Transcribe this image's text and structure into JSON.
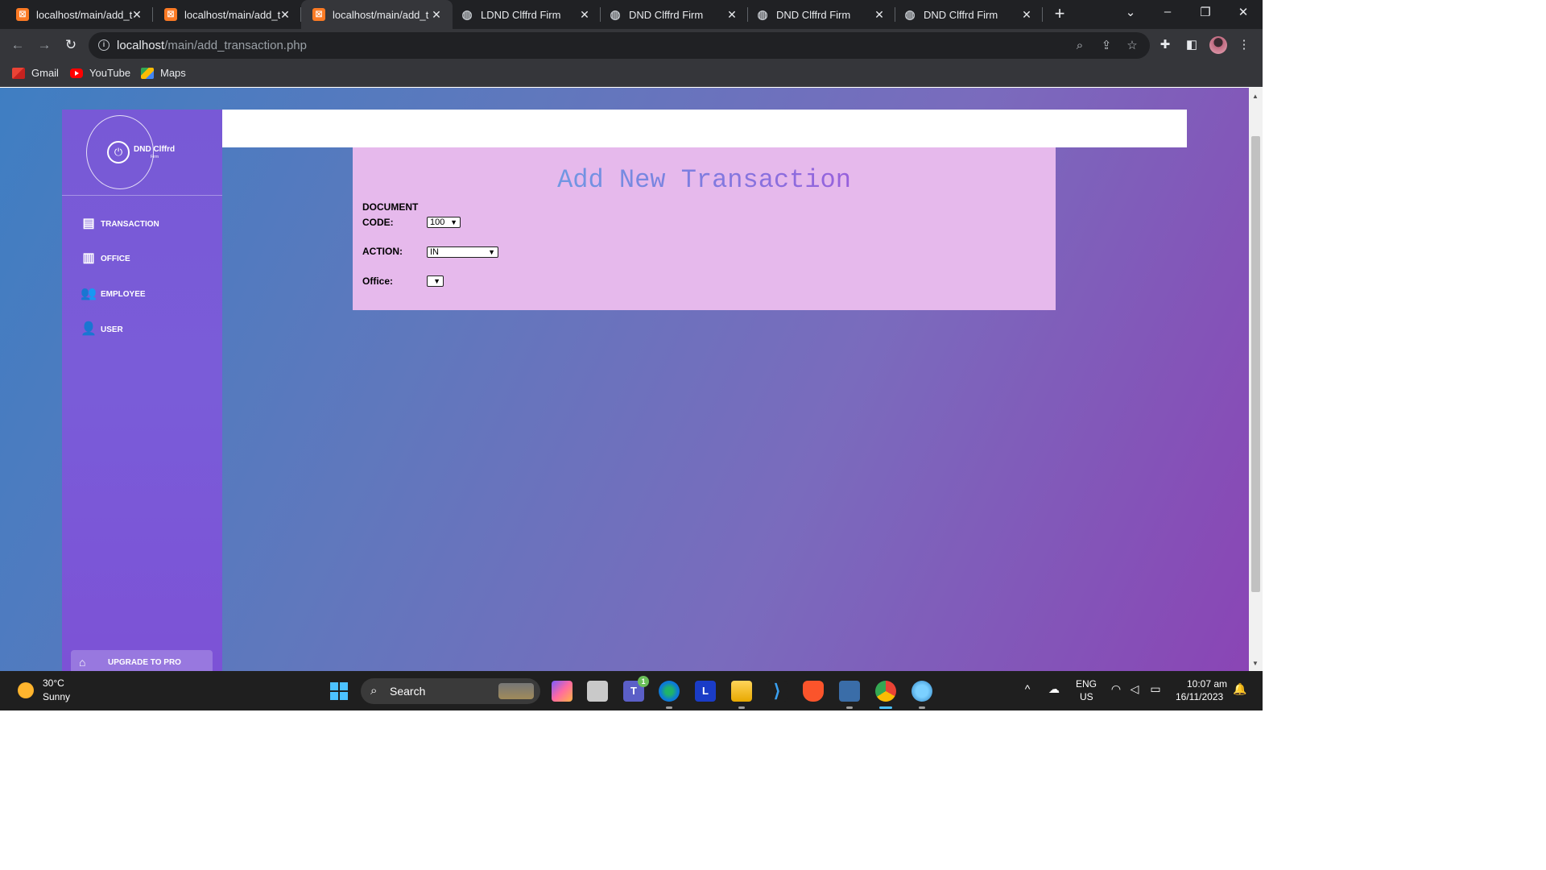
{
  "browser": {
    "tabs": [
      {
        "title": "localhost/main/add_t",
        "icon": "xampp-icon"
      },
      {
        "title": "localhost/main/add_t",
        "icon": "xampp-icon"
      },
      {
        "title": "localhost/main/add_t",
        "icon": "xampp-icon",
        "active": true
      },
      {
        "title": "LDND Clffrd Firm",
        "icon": "globe-icon"
      },
      {
        "title": "DND Clffrd Firm",
        "icon": "globe-icon"
      },
      {
        "title": "DND Clffrd Firm",
        "icon": "globe-icon"
      },
      {
        "title": "DND Clffrd Firm",
        "icon": "globe-icon"
      }
    ],
    "address": {
      "host": "localhost",
      "path": "/main/add_transaction.php"
    },
    "bookmarks": [
      "Gmail",
      "YouTube",
      "Maps"
    ]
  },
  "app": {
    "logo": {
      "name": "DND Clffrd",
      "sub": "Firm"
    },
    "nav": [
      "TRANSACTION",
      "OFFICE",
      "EMPLOYEE",
      "USER"
    ],
    "upgrade_label": "UPGRADE TO PRO"
  },
  "form": {
    "title": "Add New Transaction",
    "doc_code_label_1": "DOCUMENT",
    "doc_code_label_2": "CODE:",
    "doc_code_value": "100",
    "action_label": "ACTION:",
    "action_value": "IN",
    "office_label": "Office:",
    "office_value": ""
  },
  "taskbar": {
    "weather_temp": "30°C",
    "weather_desc": "Sunny",
    "search_label": "Search",
    "teams_badge": "1",
    "lang_1": "ENG",
    "lang_2": "US",
    "time": "10:07 am",
    "date": "16/11/2023"
  },
  "colors": {
    "sidebar": "#7859d6",
    "card": "#e6b9ec",
    "title_gradient_start": "#5fc0e8",
    "title_gradient_end": "#b83ad8"
  }
}
